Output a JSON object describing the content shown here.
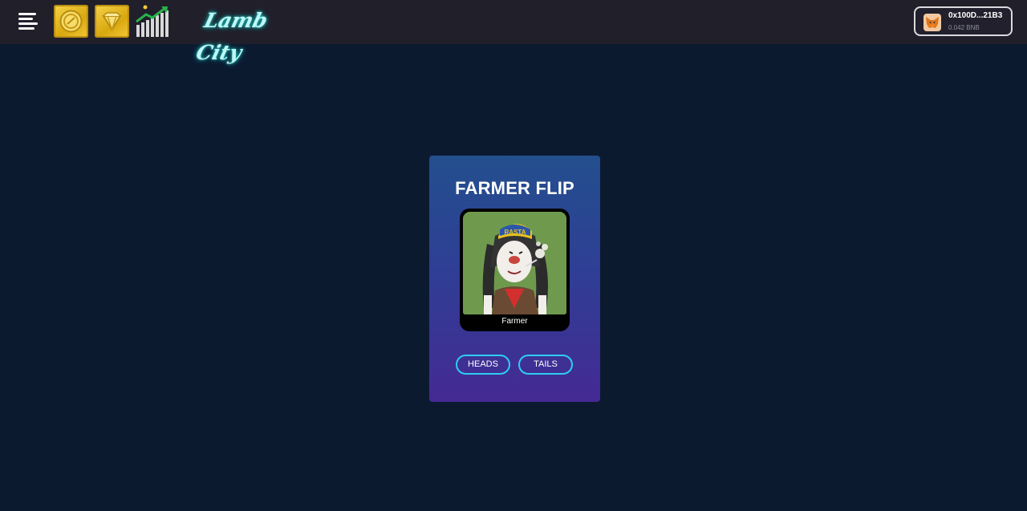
{
  "header": {
    "menu_icon": "hamburger-menu-icon",
    "tiles": [
      {
        "icon": "gold-coin-icon"
      },
      {
        "icon": "gold-diamond-icon"
      }
    ],
    "chart_icon": "growth-chart-icon",
    "logo_text": "Lamb City",
    "wallet": {
      "icon": "metamask-fox-icon",
      "address": "0x100D...21B3",
      "balance": "0.042 BNB"
    }
  },
  "card": {
    "title": "FARMER FLIP",
    "nft": {
      "cap_text": "RASTA",
      "caption": "Farmer"
    },
    "buttons": {
      "heads": "HEADS",
      "tails": "TAILS"
    }
  },
  "colors": {
    "page_bg": "#0c1a30",
    "topbar_bg": "#201f2a",
    "accent_cyan": "#2ecdf2",
    "gold": "#f3c93a"
  }
}
